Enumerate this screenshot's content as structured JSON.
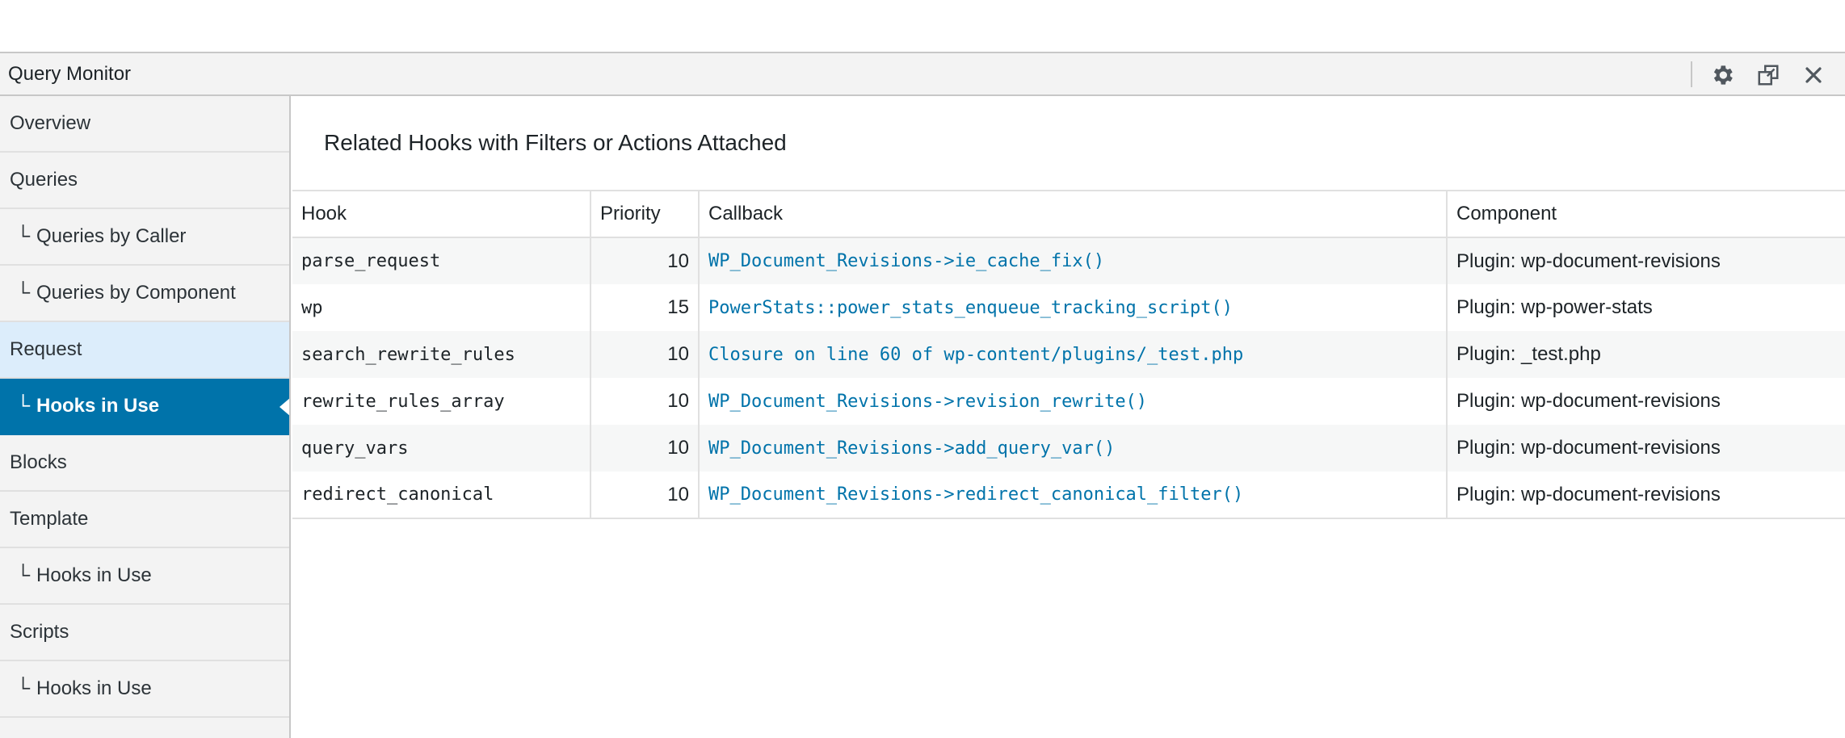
{
  "window": {
    "title": "Query Monitor",
    "icons": [
      "gear-icon",
      "popout-icon",
      "close-icon"
    ]
  },
  "sidebar": {
    "items": [
      {
        "label": "Overview",
        "sub": false
      },
      {
        "label": "Queries",
        "sub": false
      },
      {
        "label": "Queries by Caller",
        "sub": true
      },
      {
        "label": "Queries by Component",
        "sub": true
      },
      {
        "label": "Request",
        "sub": false,
        "state": "parent-active"
      },
      {
        "label": "Hooks in Use",
        "sub": true,
        "state": "active"
      },
      {
        "label": "Blocks",
        "sub": false
      },
      {
        "label": "Template",
        "sub": false
      },
      {
        "label": "Hooks in Use",
        "sub": true
      },
      {
        "label": "Scripts",
        "sub": false
      },
      {
        "label": "Hooks in Use",
        "sub": true
      }
    ],
    "tree_glyph": "└"
  },
  "main": {
    "caption": "Related Hooks with Filters or Actions Attached",
    "columns": {
      "hook": "Hook",
      "priority": "Priority",
      "callback": "Callback",
      "component": "Component"
    },
    "rows": [
      {
        "hook": "parse_request",
        "priority": "10",
        "callback": "WP_Document_Revisions->ie_cache_fix()",
        "component": "Plugin: wp-document-revisions"
      },
      {
        "hook": "wp",
        "priority": "15",
        "callback": "PowerStats::power_stats_enqueue_tracking_script()",
        "component": "Plugin: wp-power-stats"
      },
      {
        "hook": "search_rewrite_rules",
        "priority": "10",
        "callback": "Closure on line 60 of wp-content/plugins/_test.php",
        "component": "Plugin: _test.php"
      },
      {
        "hook": "rewrite_rules_array",
        "priority": "10",
        "callback": "WP_Document_Revisions->revision_rewrite()",
        "component": "Plugin: wp-document-revisions"
      },
      {
        "hook": "query_vars",
        "priority": "10",
        "callback": "WP_Document_Revisions->add_query_var()",
        "component": "Plugin: wp-document-revisions"
      },
      {
        "hook": "redirect_canonical",
        "priority": "10",
        "callback": "WP_Document_Revisions->redirect_canonical_filter()",
        "component": "Plugin: wp-document-revisions"
      }
    ]
  },
  "colors": {
    "accent": "#0073aa",
    "active_parent": "#dcedfb",
    "panel_bg": "#f3f3f3",
    "link": "#0073aa"
  }
}
